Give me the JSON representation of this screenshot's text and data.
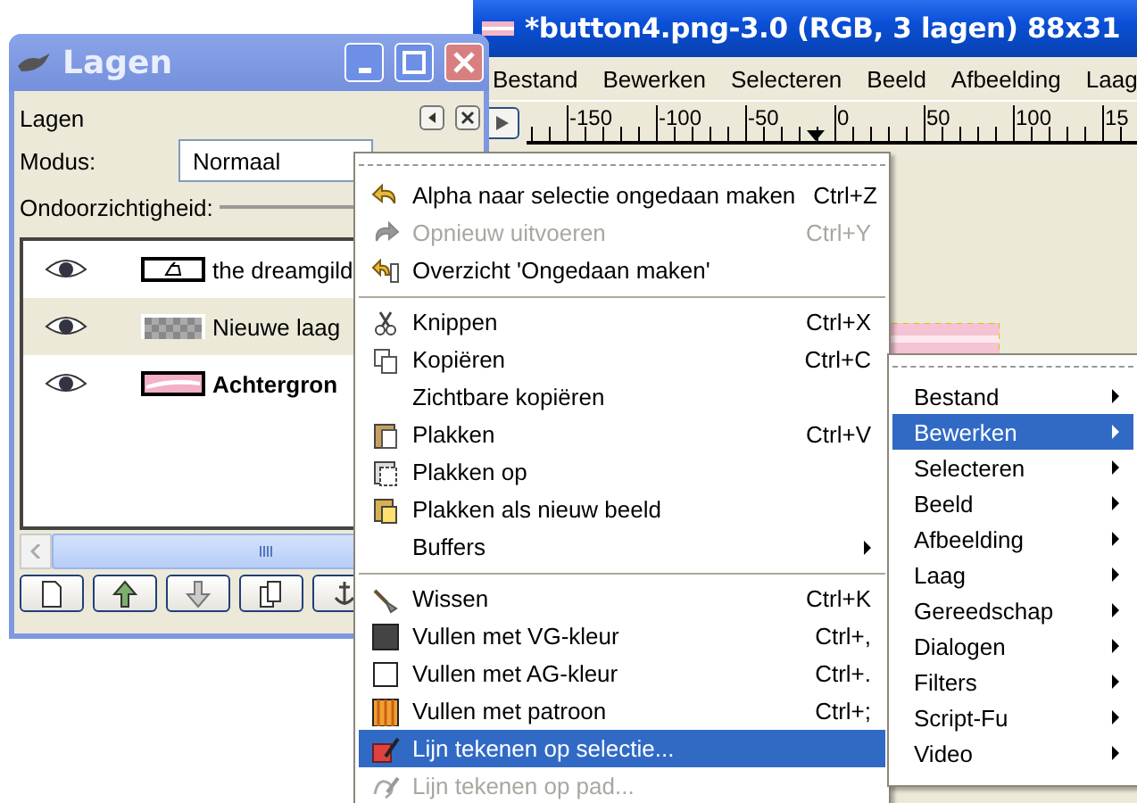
{
  "image_window": {
    "title": "*button4.png-3.0 (RGB, 3 lagen) 88x31",
    "menubar": [
      "Bestand",
      "Bewerken",
      "Selecteren",
      "Beeld",
      "Afbeelding",
      "Laag"
    ],
    "ruler": [
      "-150",
      "-100",
      "-50",
      "0",
      "50",
      "100",
      "15"
    ]
  },
  "layers_window": {
    "title": "Lagen",
    "panel_title": "Lagen",
    "mode_label": "Modus:",
    "mode_value": "Normaal",
    "opacity_label": "Ondoorzichtigheid:",
    "layers": [
      {
        "name": "the dreamgild",
        "visible": true,
        "selected": false,
        "has_alpha": true
      },
      {
        "name": "Nieuwe laag",
        "visible": true,
        "selected": true,
        "has_alpha": true
      },
      {
        "name": "Achtergron",
        "visible": true,
        "selected": false,
        "has_alpha": false
      }
    ]
  },
  "edit_menu": {
    "items": [
      {
        "kind": "item",
        "label": "Alpha naar selectie ongedaan maken",
        "shortcut": "Ctrl+Z",
        "disabled": false,
        "selected": false,
        "submenu": false
      },
      {
        "kind": "item",
        "label": "Opnieuw uitvoeren",
        "shortcut": "Ctrl+Y",
        "disabled": true,
        "selected": false,
        "submenu": false
      },
      {
        "kind": "item",
        "label": "Overzicht 'Ongedaan maken'",
        "disabled": false,
        "selected": false,
        "submenu": false
      },
      {
        "kind": "separator"
      },
      {
        "kind": "item",
        "label": "Knippen",
        "shortcut": "Ctrl+X",
        "disabled": false,
        "selected": false,
        "submenu": false
      },
      {
        "kind": "item",
        "label": "Kopiëren",
        "shortcut": "Ctrl+C",
        "disabled": false,
        "selected": false,
        "submenu": false
      },
      {
        "kind": "item",
        "label": "Zichtbare kopiëren",
        "disabled": false,
        "selected": false,
        "submenu": false
      },
      {
        "kind": "item",
        "label": "Plakken",
        "shortcut": "Ctrl+V",
        "disabled": false,
        "selected": false,
        "submenu": false
      },
      {
        "kind": "item",
        "label": "Plakken op",
        "disabled": false,
        "selected": false,
        "submenu": false
      },
      {
        "kind": "item",
        "label": "Plakken als nieuw beeld",
        "disabled": false,
        "selected": false,
        "submenu": false
      },
      {
        "kind": "item",
        "label": "Buffers",
        "disabled": false,
        "selected": false,
        "submenu": true
      },
      {
        "kind": "separator"
      },
      {
        "kind": "item",
        "label": "Wissen",
        "shortcut": "Ctrl+K",
        "disabled": false,
        "selected": false,
        "submenu": false
      },
      {
        "kind": "item",
        "label": "Vullen met VG-kleur",
        "shortcut": "Ctrl+,",
        "disabled": false,
        "selected": false,
        "submenu": false
      },
      {
        "kind": "item",
        "label": "Vullen met AG-kleur",
        "shortcut": "Ctrl+.",
        "disabled": false,
        "selected": false,
        "submenu": false
      },
      {
        "kind": "item",
        "label": "Vullen met patroon",
        "shortcut": "Ctrl+;",
        "disabled": false,
        "selected": false,
        "submenu": false
      },
      {
        "kind": "item",
        "label": "Lijn tekenen op selectie...",
        "disabled": false,
        "selected": true,
        "submenu": false
      },
      {
        "kind": "item",
        "label": "Lijn tekenen op pad...",
        "disabled": true,
        "selected": false,
        "submenu": false
      }
    ]
  },
  "image_menu": {
    "items": [
      {
        "label": "Bestand",
        "selected": false,
        "submenu": true
      },
      {
        "label": "Bewerken",
        "selected": true,
        "submenu": true
      },
      {
        "label": "Selecteren",
        "selected": false,
        "submenu": true
      },
      {
        "label": "Beeld",
        "selected": false,
        "submenu": true
      },
      {
        "label": "Afbeelding",
        "selected": false,
        "submenu": true
      },
      {
        "label": "Laag",
        "selected": false,
        "submenu": true
      },
      {
        "label": "Gereedschap",
        "selected": false,
        "submenu": true
      },
      {
        "label": "Dialogen",
        "selected": false,
        "submenu": true
      },
      {
        "label": "Filters",
        "selected": false,
        "submenu": true
      },
      {
        "label": "Script-Fu",
        "selected": false,
        "submenu": true
      },
      {
        "label": "Video",
        "selected": false,
        "submenu": true
      }
    ]
  }
}
